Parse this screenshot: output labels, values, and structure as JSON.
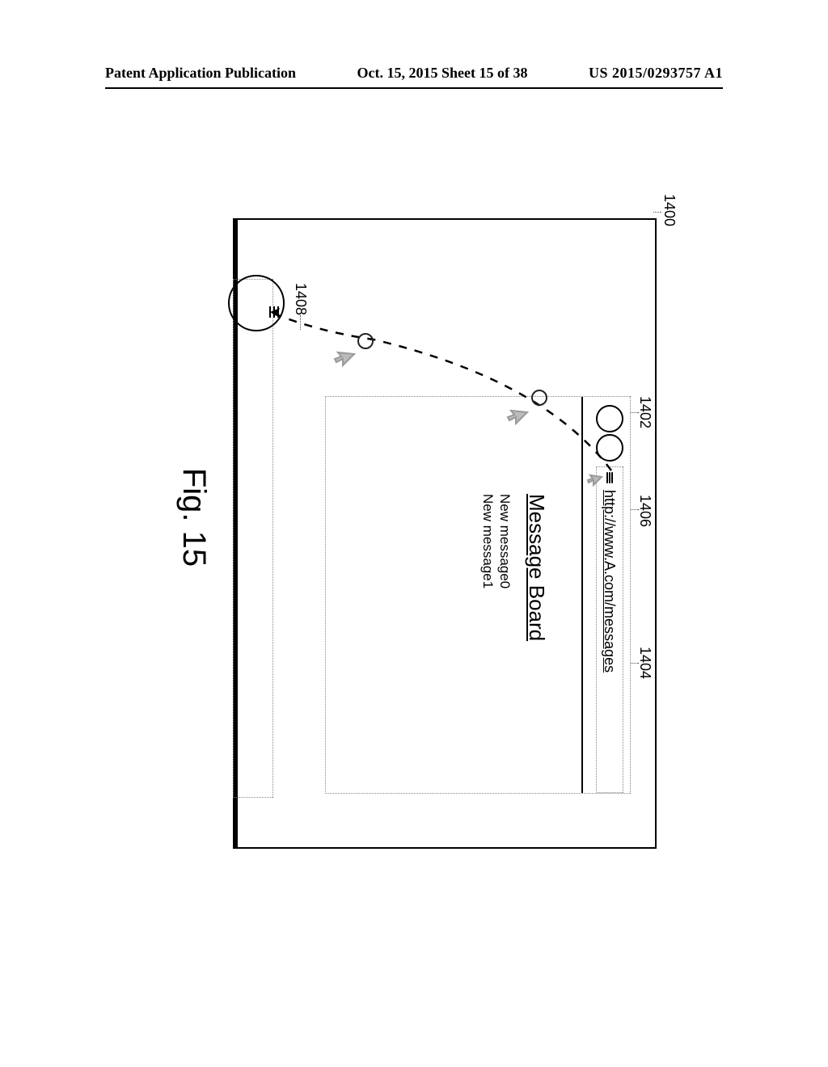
{
  "header": {
    "left": "Patent Application Publication",
    "center": "Oct. 15, 2015  Sheet 15 of 38",
    "right": "US 2015/0293757 A1"
  },
  "refs": {
    "r1400": "1400",
    "r1402": "1402",
    "r1404": "1404",
    "r1406": "1406",
    "r1408": "1408"
  },
  "browser": {
    "url": "http://www.A.com/messages",
    "title": "Message Board",
    "messages": [
      "New message0",
      "New message1"
    ]
  },
  "figure_caption": "Fig. 15"
}
